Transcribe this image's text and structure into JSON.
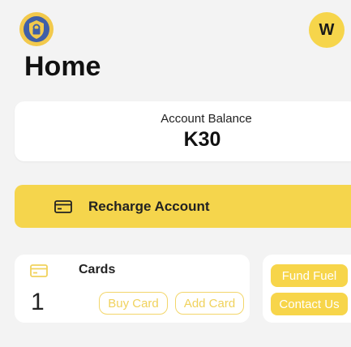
{
  "header": {
    "title": "Home",
    "avatar_initial": "W",
    "logo_icon": "shield-lock-icon"
  },
  "balance": {
    "label": "Account Balance",
    "value": "K30"
  },
  "recharge": {
    "label": "Recharge Account",
    "icon": "card-icon"
  },
  "cards": {
    "label": "Cards",
    "count": "1",
    "icon": "card-icon",
    "buy_label": "Buy Card",
    "add_label": "Add Card"
  },
  "actions": {
    "fund_fuel_label": "Fund Fuel",
    "contact_label": "Contact Us"
  },
  "colors": {
    "accent": "#f5d54c",
    "background": "#f3f3f3",
    "logo_blue": "#3f5fa8"
  }
}
